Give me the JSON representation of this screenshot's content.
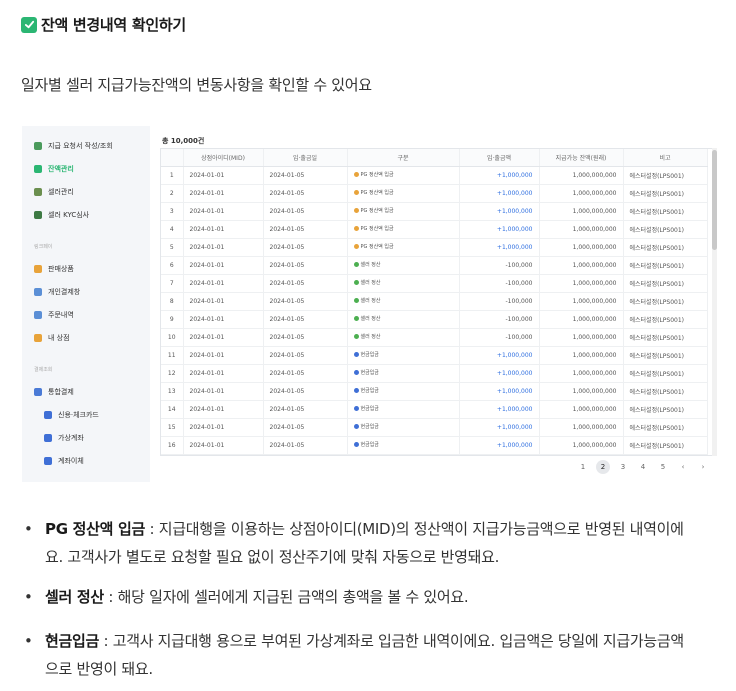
{
  "title": "잔액 변경내역 확인하기",
  "intro": "일자별 셀러 지급가능잔액의 변동사항을 확인할 수 있어요",
  "sidebar": {
    "items": [
      {
        "label": "지급 요청서 작성/조회",
        "color": "#4a9a5c"
      },
      {
        "label": "잔액관리",
        "color": "#2bb673",
        "active": true
      },
      {
        "label": "셀러관리",
        "color": "#6b8f4f"
      },
      {
        "label": "셀러 KYC심사",
        "color": "#3d7a44"
      }
    ],
    "section1": "링크페이",
    "items2": [
      {
        "label": "판매상품",
        "color": "#e8a33a"
      },
      {
        "label": "개인결제창",
        "color": "#5b8fd6"
      },
      {
        "label": "주문내역",
        "color": "#5b8fd6"
      },
      {
        "label": "내 상점",
        "color": "#e8a33a"
      }
    ],
    "section2": "결제조회",
    "items3": [
      {
        "label": "통합결제",
        "color": "#4a7ad6"
      },
      {
        "label": "신용·체크카드",
        "color": "#3f6fd6",
        "sub": true
      },
      {
        "label": "가상계좌",
        "color": "#3f6fd6",
        "sub": true
      },
      {
        "label": "계좌이체",
        "color": "#3f6fd6",
        "sub": true
      }
    ]
  },
  "table": {
    "total": "총 10,000건",
    "headers": [
      "",
      "상점아이디(MID)",
      "입·출금일",
      "구분",
      "입·출금액",
      "지급가능 잔액(원래)",
      "비고"
    ],
    "rows": [
      {
        "no": "1",
        "mid": "2024-01-01",
        "date": "2024-01-05",
        "type": "PG 정산액 입금",
        "kind": "pg",
        "amt": "+1,000,000",
        "bal": "1,000,000,000",
        "note": "에스터설정(LPS001)"
      },
      {
        "no": "2",
        "mid": "2024-01-01",
        "date": "2024-01-05",
        "type": "PG 정산액 입금",
        "kind": "pg",
        "amt": "+1,000,000",
        "bal": "1,000,000,000",
        "note": "에스터설정(LPS001)"
      },
      {
        "no": "3",
        "mid": "2024-01-01",
        "date": "2024-01-05",
        "type": "PG 정산액 입금",
        "kind": "pg",
        "amt": "+1,000,000",
        "bal": "1,000,000,000",
        "note": "에스터설정(LPS001)"
      },
      {
        "no": "4",
        "mid": "2024-01-01",
        "date": "2024-01-05",
        "type": "PG 정산액 입금",
        "kind": "pg",
        "amt": "+1,000,000",
        "bal": "1,000,000,000",
        "note": "에스터설정(LPS001)"
      },
      {
        "no": "5",
        "mid": "2024-01-01",
        "date": "2024-01-05",
        "type": "PG 정산액 입금",
        "kind": "pg",
        "amt": "+1,000,000",
        "bal": "1,000,000,000",
        "note": "에스터설정(LPS001)"
      },
      {
        "no": "6",
        "mid": "2024-01-01",
        "date": "2024-01-05",
        "type": "셀러 정산",
        "kind": "seller",
        "amt": "-100,000",
        "bal": "1,000,000,000",
        "note": "에스터설정(LPS001)"
      },
      {
        "no": "7",
        "mid": "2024-01-01",
        "date": "2024-01-05",
        "type": "셀러 정산",
        "kind": "seller",
        "amt": "-100,000",
        "bal": "1,000,000,000",
        "note": "에스터설정(LPS001)"
      },
      {
        "no": "8",
        "mid": "2024-01-01",
        "date": "2024-01-05",
        "type": "셀러 정산",
        "kind": "seller",
        "amt": "-100,000",
        "bal": "1,000,000,000",
        "note": "에스터설정(LPS001)"
      },
      {
        "no": "9",
        "mid": "2024-01-01",
        "date": "2024-01-05",
        "type": "셀러 정산",
        "kind": "seller",
        "amt": "-100,000",
        "bal": "1,000,000,000",
        "note": "에스터설정(LPS001)"
      },
      {
        "no": "10",
        "mid": "2024-01-01",
        "date": "2024-01-05",
        "type": "셀러 정산",
        "kind": "seller",
        "amt": "-100,000",
        "bal": "1,000,000,000",
        "note": "에스터설정(LPS001)"
      },
      {
        "no": "11",
        "mid": "2024-01-01",
        "date": "2024-01-05",
        "type": "현금입금",
        "kind": "cash",
        "amt": "+1,000,000",
        "bal": "1,000,000,000",
        "note": "에스터설정(LPS001)"
      },
      {
        "no": "12",
        "mid": "2024-01-01",
        "date": "2024-01-05",
        "type": "현금입금",
        "kind": "cash",
        "amt": "+1,000,000",
        "bal": "1,000,000,000",
        "note": "에스터설정(LPS001)"
      },
      {
        "no": "13",
        "mid": "2024-01-01",
        "date": "2024-01-05",
        "type": "현금입금",
        "kind": "cash",
        "amt": "+1,000,000",
        "bal": "1,000,000,000",
        "note": "에스터설정(LPS001)"
      },
      {
        "no": "14",
        "mid": "2024-01-01",
        "date": "2024-01-05",
        "type": "현금입금",
        "kind": "cash",
        "amt": "+1,000,000",
        "bal": "1,000,000,000",
        "note": "에스터설정(LPS001)"
      },
      {
        "no": "15",
        "mid": "2024-01-01",
        "date": "2024-01-05",
        "type": "현금입금",
        "kind": "cash",
        "amt": "+1,000,000",
        "bal": "1,000,000,000",
        "note": "에스터설정(LPS001)"
      },
      {
        "no": "16",
        "mid": "2024-01-01",
        "date": "2024-01-05",
        "type": "현금입금",
        "kind": "cash",
        "amt": "+1,000,000",
        "bal": "1,000,000,000",
        "note": "에스터설정(LPS001)"
      }
    ],
    "kind_colors": {
      "pg": "#e8a33a",
      "seller": "#4caf50",
      "cash": "#3f6fd6"
    }
  },
  "pagination": {
    "pages": [
      "1",
      "2",
      "3",
      "4",
      "5"
    ],
    "current": "2",
    "prev": "‹",
    "next": "›"
  },
  "bullets": [
    {
      "term": "PG 정산액 입금",
      "desc": " : 지급대행을 이용하는 상점아이디(MID)의 정산액이 지급가능금액으로 반영된 내역이에요. 고객사가 별도로 요청할 필요 없이 정산주기에 맞춰 자동으로 반영돼요."
    },
    {
      "term": "셀러 정산",
      "desc": " : 해당 일자에 셀러에게 지급된 금액의 총액을 볼 수 있어요."
    },
    {
      "term": "현금입금",
      "desc": " : 고객사 지급대행 용으로 부여된 가상계좌로 입금한 내역이에요. 입금액은 당일에 지급가능금액으로 반영이 돼요."
    }
  ]
}
